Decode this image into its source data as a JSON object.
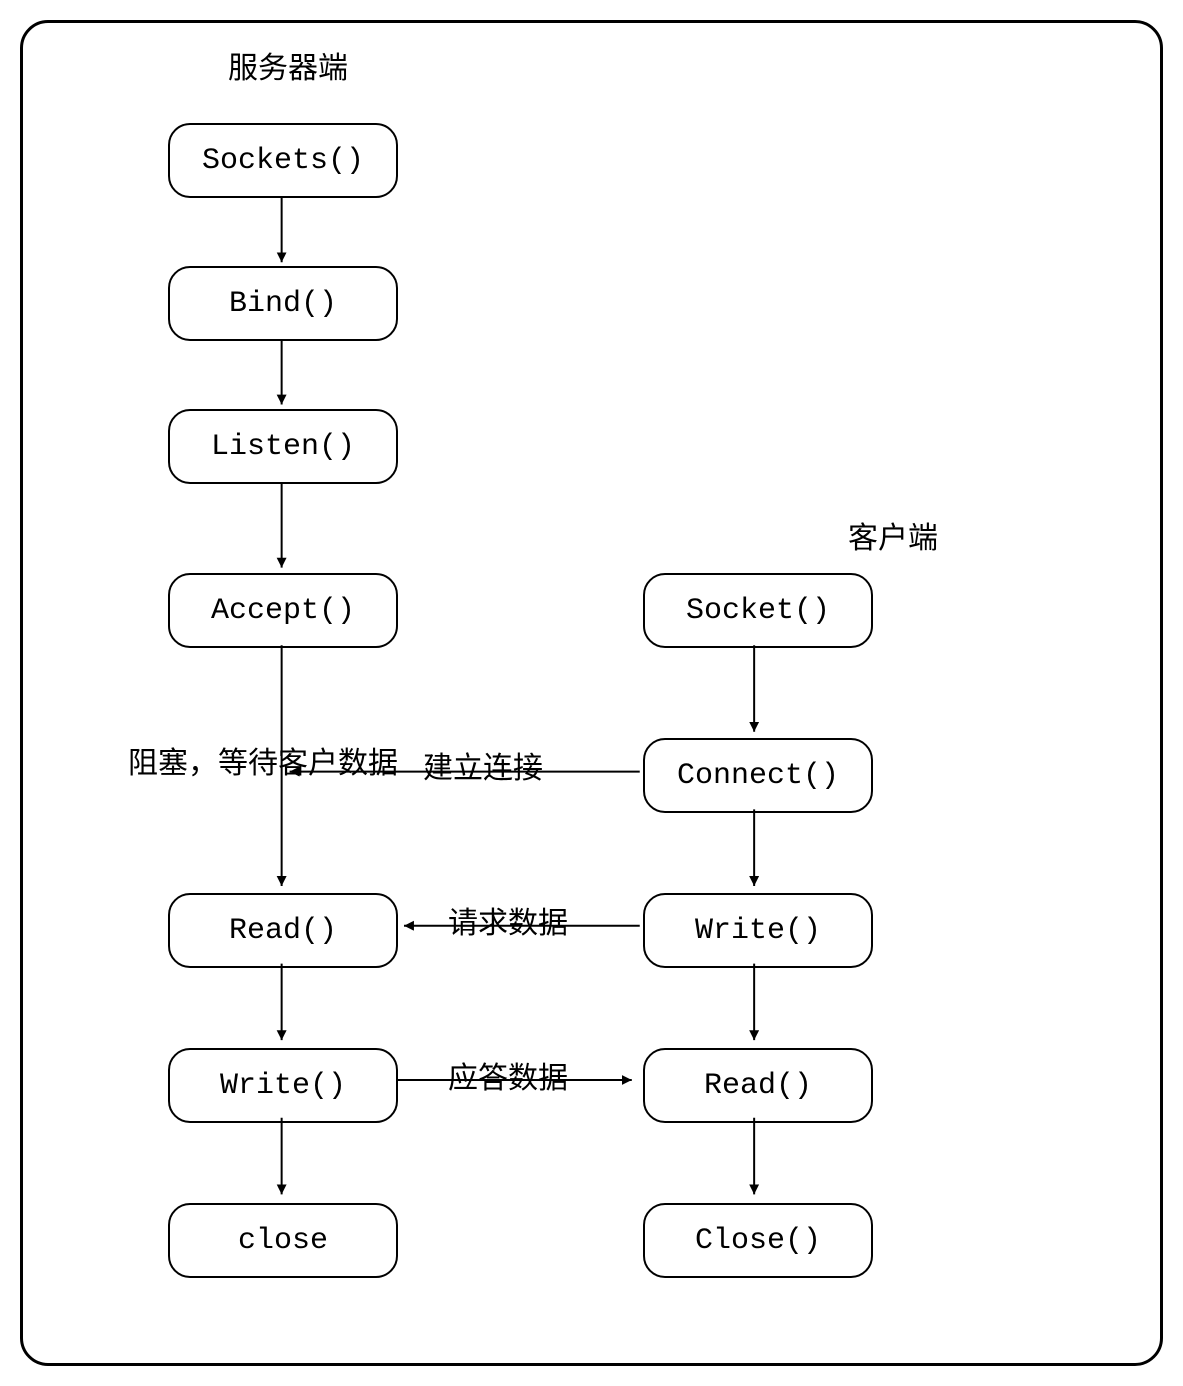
{
  "titles": {
    "server": "服务器端",
    "client": "客户端"
  },
  "server": {
    "sockets": "Sockets()",
    "bind": "Bind()",
    "listen": "Listen()",
    "accept": "Accept()",
    "read": "Read()",
    "write": "Write()",
    "close": "close"
  },
  "client": {
    "socket": "Socket()",
    "connect": "Connect()",
    "write": "Write()",
    "read": "Read()",
    "close": "Close()"
  },
  "edges": {
    "block_wait": "阻塞，等待客户数据",
    "establish": "建立连接",
    "request": "请求数据",
    "response": "应答数据"
  }
}
